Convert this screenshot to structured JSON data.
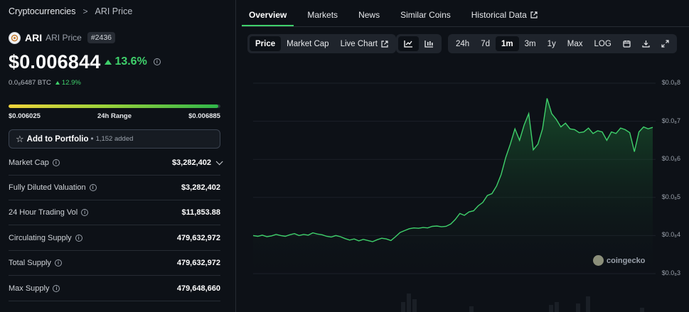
{
  "breadcrumb": {
    "root": "Cryptocurrencies",
    "separator": ">",
    "current": "ARI Price"
  },
  "coin": {
    "symbol": "ARI",
    "name": "ARI Price",
    "rank": "#2436"
  },
  "price": {
    "value": "$0.006844",
    "change": "13.6%",
    "btc_value": "0.0₈6487 BTC",
    "btc_change": "12.9%"
  },
  "range": {
    "low": "$0.006025",
    "label": "24h Range",
    "high": "$0.006885",
    "position": 0.99
  },
  "portfolio": {
    "label": "Add to Portfolio",
    "dot": "•",
    "added": "1,152 added"
  },
  "stats": [
    {
      "label": "Market Cap",
      "value": "$3,282,402"
    },
    {
      "label": "Fully Diluted Valuation",
      "value": "$3,282,402"
    },
    {
      "label": "24 Hour Trading Vol",
      "value": "$11,853.88"
    },
    {
      "label": "Circulating Supply",
      "value": "479,632,972"
    },
    {
      "label": "Total Supply",
      "value": "479,632,972"
    },
    {
      "label": "Max Supply",
      "value": "479,648,660"
    }
  ],
  "tabs": [
    {
      "label": "Overview"
    },
    {
      "label": "Markets"
    },
    {
      "label": "News"
    },
    {
      "label": "Similar Coins"
    },
    {
      "label": "Historical Data"
    }
  ],
  "chart_controls": {
    "type_tabs": [
      "Price",
      "Market Cap",
      "Live Chart"
    ],
    "ranges": [
      "24h",
      "7d",
      "1m",
      "3m",
      "1y",
      "Max",
      "LOG"
    ],
    "selected_range": "1m"
  },
  "chart": {
    "watermark": "coingecko",
    "y_ticks": [
      "$0.0₈8",
      "$0.0₈7",
      "$0.0₈6",
      "$0.0₈5",
      "$0.0₈4",
      "$0.0₈3"
    ]
  },
  "colors": {
    "accent_green": "#3fd06b",
    "background": "#0d1117",
    "panel": "#1f242c"
  },
  "chart_data": {
    "type": "area",
    "title": "",
    "xlabel": "",
    "ylabel": "",
    "ylim": [
      0.003,
      0.008
    ],
    "grid": true,
    "values": [
      0.004,
      0.00398,
      0.00401,
      0.00397,
      0.00399,
      0.00403,
      0.004,
      0.00398,
      0.00402,
      0.00405,
      0.004,
      0.00403,
      0.00401,
      0.00407,
      0.00404,
      0.00402,
      0.00398,
      0.00396,
      0.004,
      0.00397,
      0.00392,
      0.00388,
      0.00391,
      0.00386,
      0.0039,
      0.00387,
      0.00384,
      0.00389,
      0.00393,
      0.00391,
      0.00387,
      0.00397,
      0.00408,
      0.00413,
      0.00418,
      0.0042,
      0.00419,
      0.00421,
      0.0042,
      0.00424,
      0.00425,
      0.00423,
      0.00424,
      0.0043,
      0.00442,
      0.00458,
      0.00453,
      0.00462,
      0.00465,
      0.00478,
      0.00487,
      0.00505,
      0.0051,
      0.0053,
      0.0056,
      0.00605,
      0.0064,
      0.0068,
      0.0065,
      0.0069,
      0.0072,
      0.00625,
      0.0064,
      0.0068,
      0.0076,
      0.0072,
      0.00705,
      0.00685,
      0.00695,
      0.0068,
      0.00678,
      0.0067,
      0.00672,
      0.00682,
      0.00668,
      0.00675,
      0.00672,
      0.0065,
      0.00672,
      0.00668,
      0.00682,
      0.00678,
      0.0067,
      0.0062,
      0.00672,
      0.00685,
      0.0068,
      0.00684
    ]
  }
}
